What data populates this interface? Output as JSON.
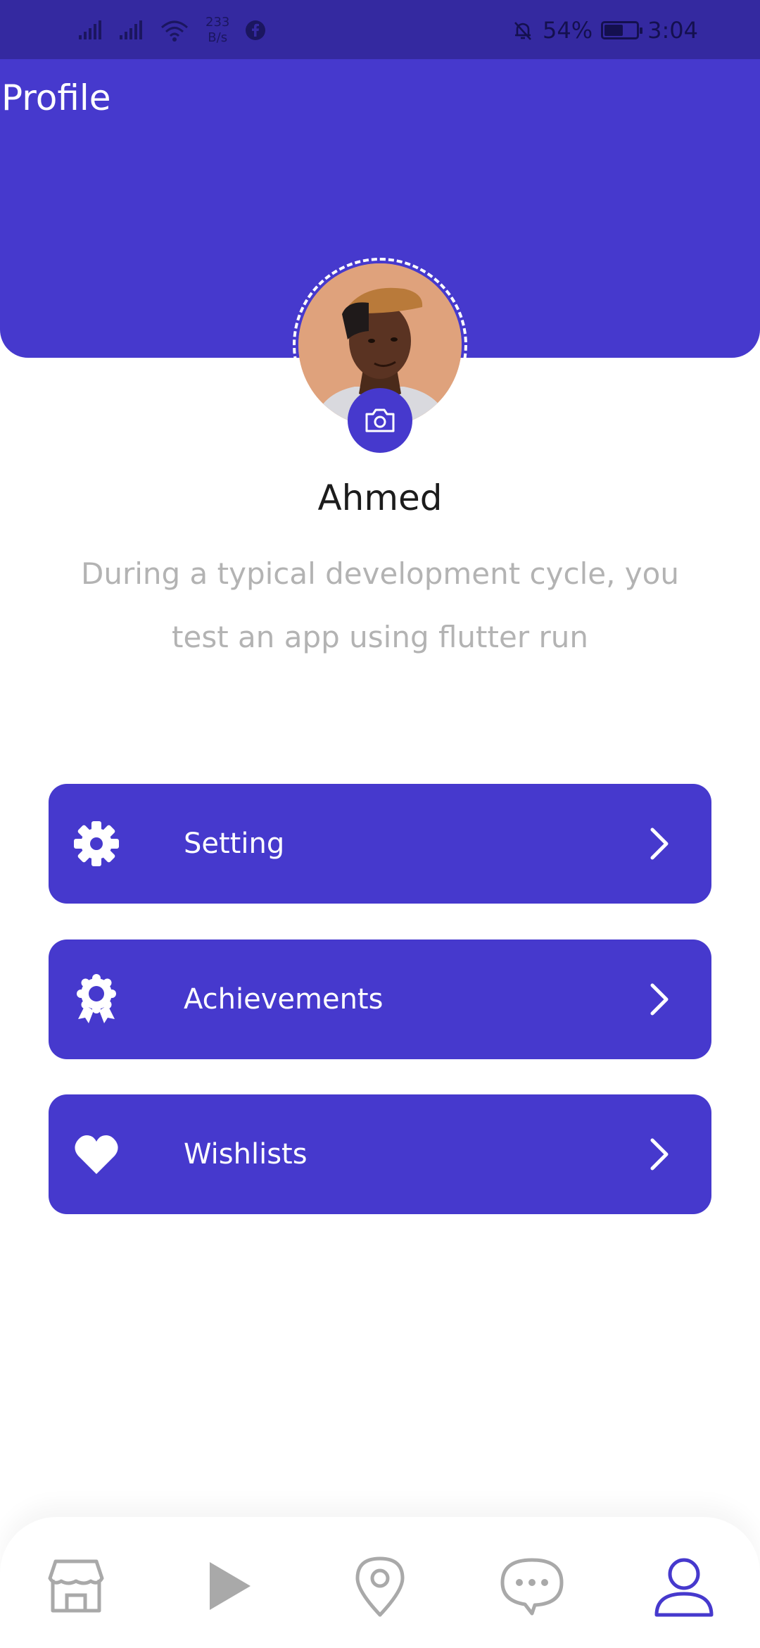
{
  "status_bar": {
    "net_speed": "233",
    "net_unit": "B/s",
    "battery": "54%",
    "time": "3:04"
  },
  "header": {
    "title": "Profile"
  },
  "profile": {
    "name": "Ahmed",
    "bio": "During a typical development cycle, you test an app using flutter run"
  },
  "menu": [
    {
      "label": "Setting",
      "icon": "gear-icon"
    },
    {
      "label": "Achievements",
      "icon": "award-icon"
    },
    {
      "label": "Wishlists",
      "icon": "heart-icon"
    }
  ],
  "bottom_nav": [
    {
      "icon": "store-icon",
      "active": false
    },
    {
      "icon": "play-icon",
      "active": false
    },
    {
      "icon": "location-pin-icon",
      "active": false
    },
    {
      "icon": "chat-icon",
      "active": false
    },
    {
      "icon": "user-icon",
      "active": true
    }
  ],
  "colors": {
    "primary": "#4639cd",
    "status_bar": "#3429a0",
    "nav_inactive": "#a9a9a9",
    "bio_text": "#b3b3b3"
  }
}
